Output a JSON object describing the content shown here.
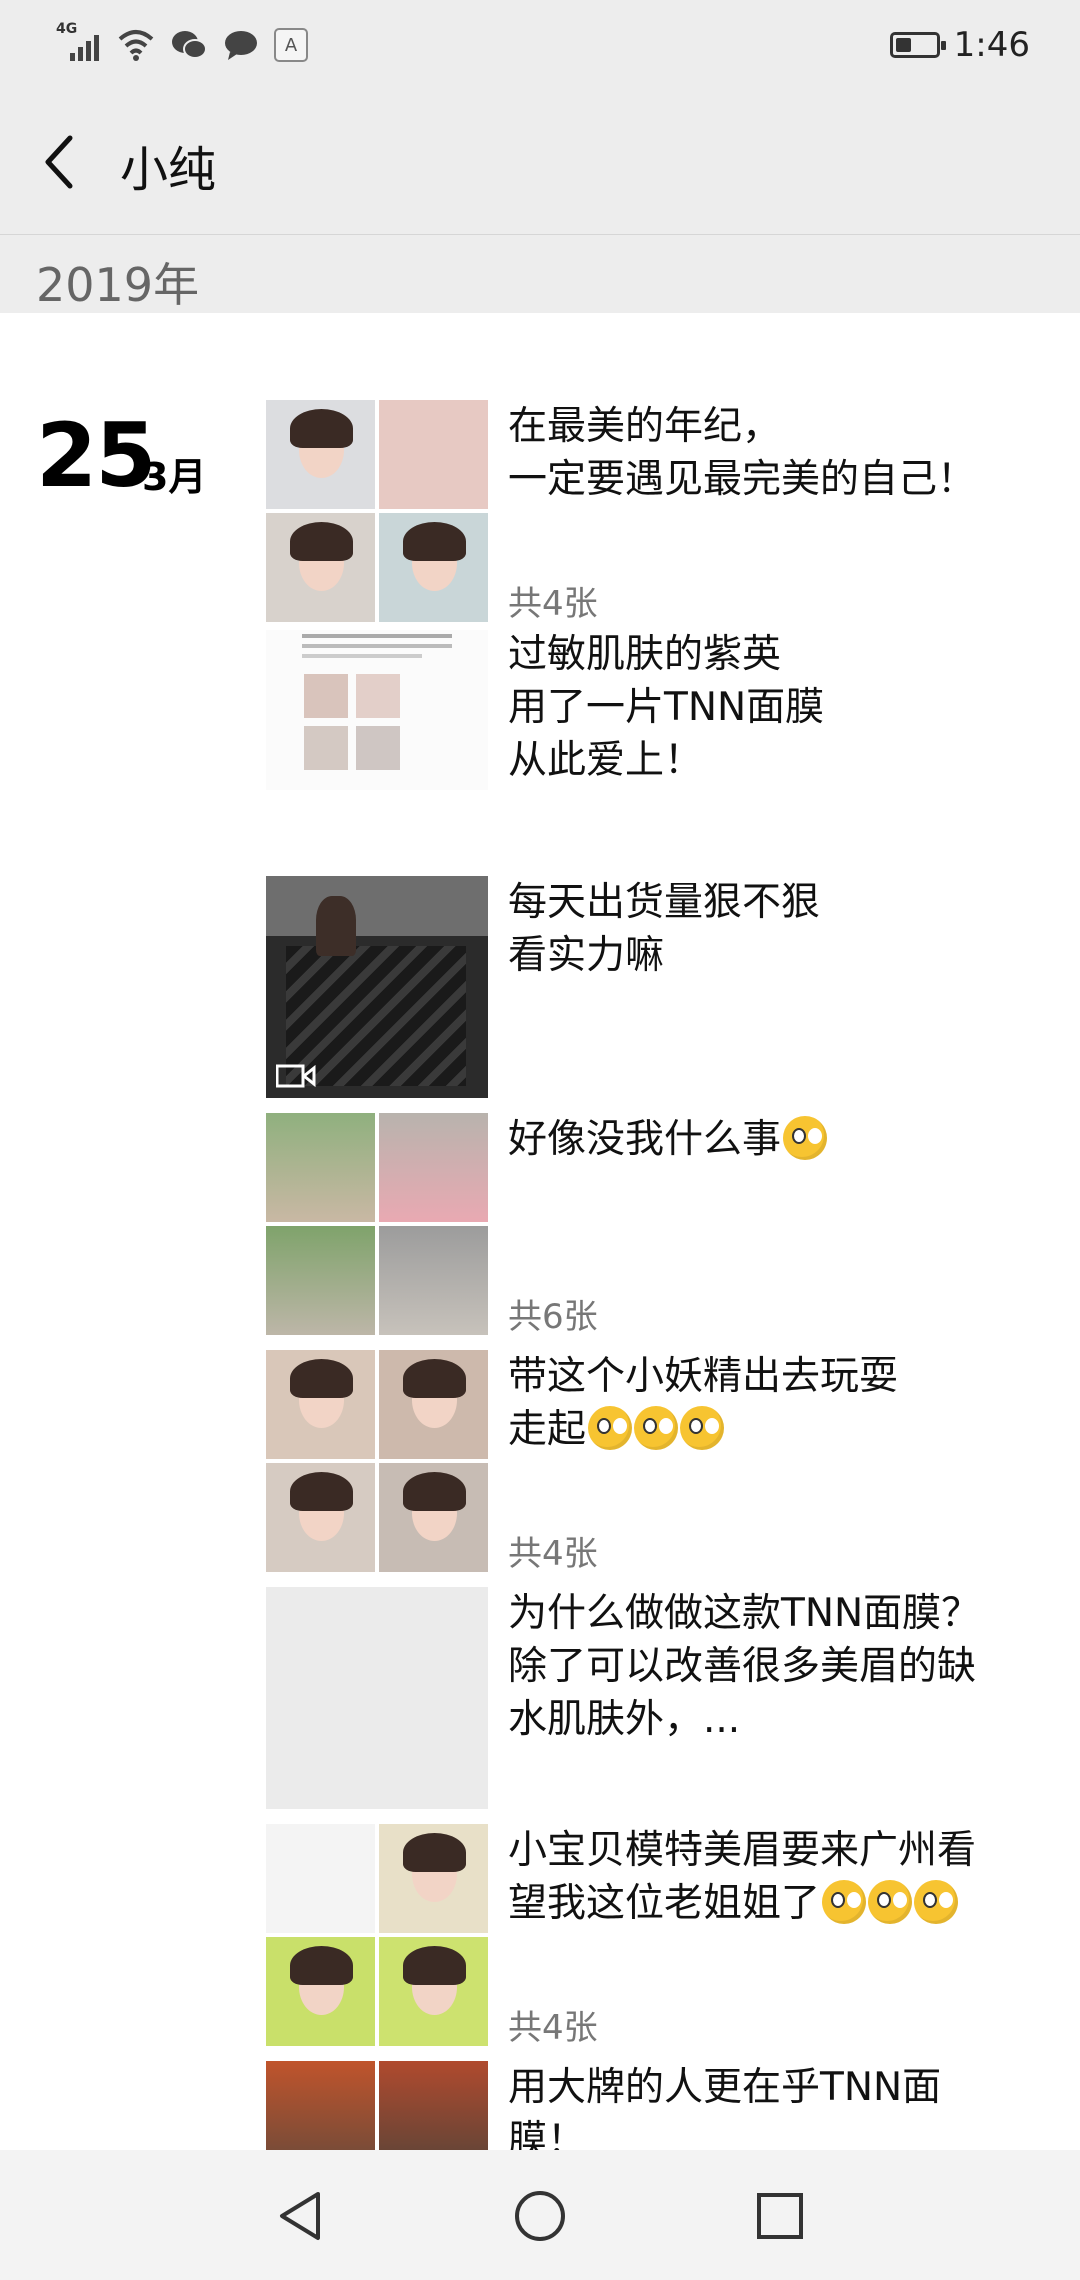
{
  "status_bar": {
    "network_label": "4G",
    "time": "1:46",
    "input_badge": "A",
    "battery_level": 0.4
  },
  "header": {
    "title": "小纯"
  },
  "year_header": "2019年",
  "date": {
    "day": "25",
    "month": "3月"
  },
  "posts": [
    {
      "text_line1": "在最美的年纪，",
      "text_line2": "一定要遇见最完美的自己！",
      "count": "共4张"
    },
    {
      "text_line1": "过敏肌肤的紫英",
      "text_line2": "用了一片TNN面膜",
      "text_line3": "从此爱上！"
    },
    {
      "text_line1": "每天出货量狠不狠",
      "text_line2": "看实力嘛"
    },
    {
      "text_line1": "好像没我什么事",
      "count": "共6张"
    },
    {
      "text_line1": "带这个小妖精出去玩耍",
      "text_line2": "走起",
      "count": "共4张"
    },
    {
      "text_line1": "为什么做做这款TNN面膜？",
      "text_line2": "除了可以改善很多美眉的缺",
      "text_line3": "水肌肤外，..."
    },
    {
      "text_line1": "小宝贝模特美眉要来广州看",
      "text_line2": "望我这位老姐姐了",
      "count": "共4张"
    },
    {
      "text_line1": "用大牌的人更在乎TNN面",
      "text_line2": "膜！"
    }
  ],
  "icons": {
    "back": "chevron-left-icon",
    "video": "video-icon",
    "nav_back": "triangle-back-icon",
    "nav_home": "circle-home-icon",
    "nav_recents": "square-recents-icon"
  }
}
